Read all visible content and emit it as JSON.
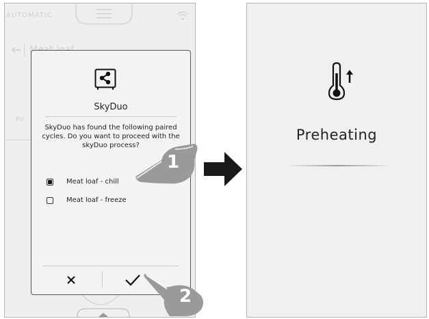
{
  "left_screen": {
    "header_mode": "AUTOMATIC",
    "back_title": "Meat loaf",
    "faded_label": "Po",
    "dialog": {
      "title": "SkyDuo",
      "message": "SkyDuo has found the following paired cycles. Do you want to proceed with the skyDuo process?",
      "options": [
        {
          "label": "Meat loaf - chill",
          "checked": true
        },
        {
          "label": "Meat loaf - freeze",
          "checked": false
        }
      ],
      "cancel_symbol": "✕",
      "confirm_symbol": "✓"
    }
  },
  "steps": [
    "1",
    "2"
  ],
  "right_screen": {
    "title": "Preheating"
  },
  "colors": {
    "screen_bg": "#efefef",
    "hand": "#9a9a9a",
    "arrow": "#1a1a1a"
  }
}
